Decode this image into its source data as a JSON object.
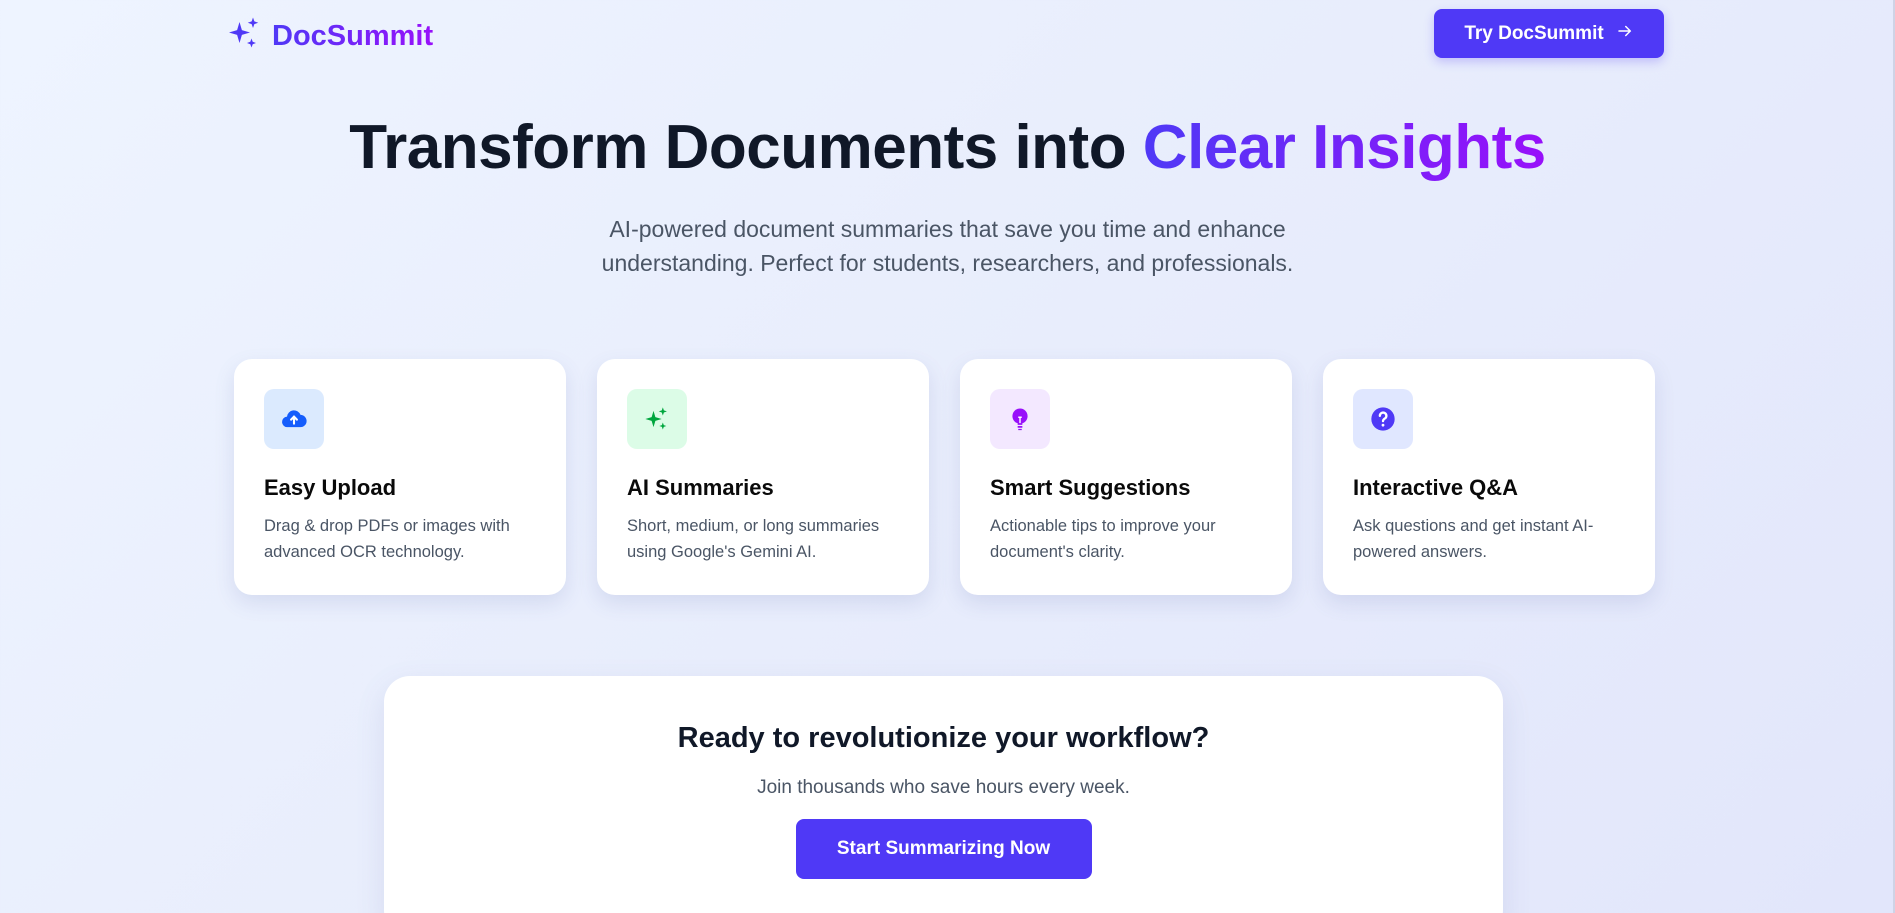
{
  "header": {
    "brand": "DocSummit",
    "logo_icon": "sparkles-icon",
    "cta_label": "Try DocSummit",
    "cta_icon": "arrow-right-icon"
  },
  "hero": {
    "title_part1": "Transform Documents into ",
    "title_highlight": "Clear Insights",
    "subtitle_line1": "AI-powered document summaries that save you time and enhance",
    "subtitle_line2": "understanding. Perfect for students, researchers, and professionals."
  },
  "features": [
    {
      "title": "Easy Upload",
      "desc": "Drag & drop PDFs or images with advanced OCR technology.",
      "icon": "cloud-upload-icon",
      "color": "#155dfc",
      "bg": "#dbeafe"
    },
    {
      "title": "AI Summaries",
      "desc": "Short, medium, or long summaries using Google's Gemini AI.",
      "icon": "sparkles-icon",
      "color": "#00a63e",
      "bg": "#dcfce7"
    },
    {
      "title": "Smart Suggestions",
      "desc": "Actionable tips to improve your document's clarity.",
      "icon": "lightbulb-icon",
      "color": "#9810fa",
      "bg": "#f3e8ff"
    },
    {
      "title": "Interactive Q&A",
      "desc": "Ask questions and get instant AI-powered answers.",
      "icon": "question-circle-icon",
      "color": "#4f39f6",
      "bg": "#e0e7ff"
    }
  ],
  "cta": {
    "title": "Ready to revolutionize your workflow?",
    "subtitle": "Join thousands who save hours every week.",
    "button": "Start Summarizing Now"
  },
  "colors": {
    "primary": "#4f39f6",
    "accent": "#9810fa"
  }
}
